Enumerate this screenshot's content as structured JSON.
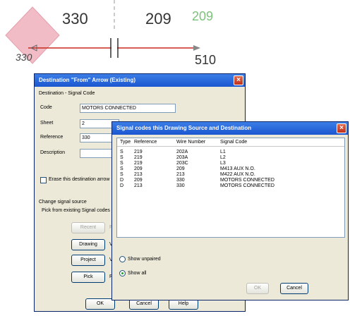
{
  "drawing": {
    "wire_left": "330",
    "wire_right": "209",
    "wire_right_alt": "209",
    "wire_right_alt_color": "#7cc27c",
    "wire_below": "510",
    "symbol_label": "330",
    "symbol_color": "#f2bcc6",
    "wire_color": "#c8281e"
  },
  "from_dialog": {
    "title": "Destination \"From\" Arrow (Existing)",
    "group_label": "Destination - Signal Code",
    "code_label": "Code",
    "code_value": "MOTORS CONNECTED",
    "sheet_label": "Sheet",
    "sheet_value": "2",
    "reference_label": "Reference",
    "reference_value": "330",
    "description_label": "Description",
    "description_value": "",
    "erase_label": "Erase this destination arrow",
    "change_source_label": "Change signal source",
    "pick_existing_label": "Pick from existing Signal codes",
    "recent_button": "Recent",
    "recent_side": "F",
    "drawing_button": "Drawing",
    "drawing_side": "V",
    "project_button": "Project",
    "project_side": "V",
    "pick_button": "Pick",
    "pick_side": "P",
    "ok_button": "OK",
    "cancel_button": "Cancel",
    "help_button": "Help"
  },
  "codes_dialog": {
    "title": "Signal codes    this Drawing   Source and Destination",
    "columns": [
      "Type",
      "Reference",
      "Wire Number",
      "Signal Code"
    ],
    "rows": [
      [
        "S",
        "219",
        "202A",
        "L1"
      ],
      [
        "S",
        "219",
        "203A",
        "L2"
      ],
      [
        "S",
        "219",
        "203C",
        "L3"
      ],
      [
        "S",
        "209",
        "209",
        "M413 AUX N.O."
      ],
      [
        "S",
        "213",
        "213",
        "M422 AUX N.O."
      ],
      [
        "D",
        "209",
        "330",
        "MOTORS CONNECTED"
      ],
      [
        "D",
        "213",
        "330",
        "MOTORS CONNECTED"
      ]
    ],
    "show_unpaired_label": "Show unpaired",
    "show_all_label": "Show all",
    "selected_filter": "Show all",
    "ok_button": "OK",
    "cancel_button": "Cancel"
  }
}
